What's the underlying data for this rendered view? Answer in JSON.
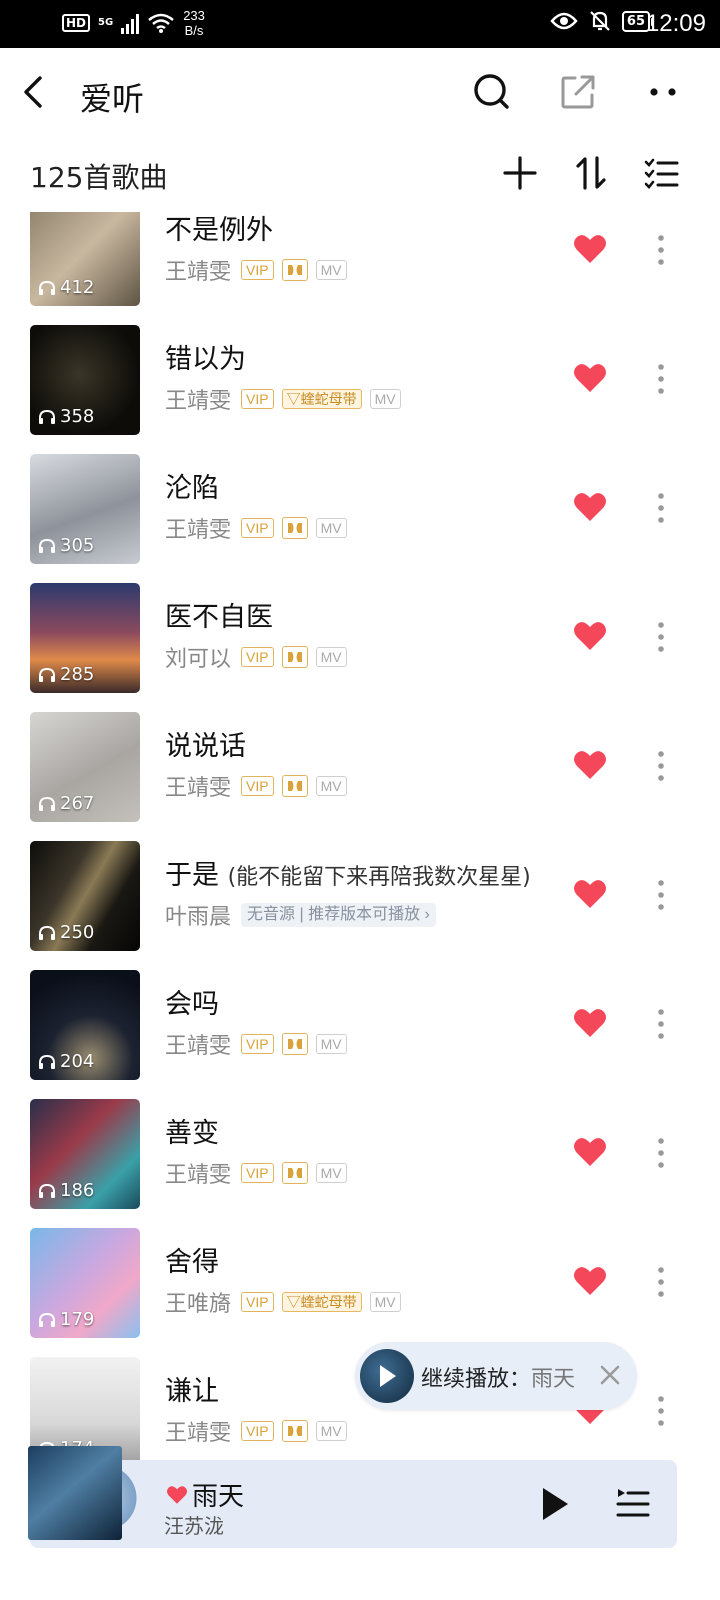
{
  "status_bar": {
    "hd": "HD",
    "network": "5G",
    "speed_value": "233",
    "speed_unit": "B/s",
    "battery": "65",
    "time": "12:09"
  },
  "header": {
    "title": "爱听",
    "icons": [
      "back-icon",
      "search-icon",
      "share-icon",
      "more-icon"
    ]
  },
  "list_header": {
    "count_label": "125首歌曲",
    "icons": [
      "add-icon",
      "sort-icon",
      "multi-select-icon"
    ]
  },
  "tags": {
    "vip": "VIP",
    "mv": "MV",
    "snake": "蝰蛇母带"
  },
  "songs": [
    {
      "title": "不是例外",
      "artist": "王靖雯",
      "plays": "412"
    },
    {
      "title": "错以为",
      "artist": "王靖雯",
      "plays": "358"
    },
    {
      "title": "沦陷",
      "artist": "王靖雯",
      "plays": "305"
    },
    {
      "title": "医不自医",
      "artist": "刘可以",
      "plays": "285"
    },
    {
      "title": "说说话",
      "artist": "王靖雯",
      "plays": "267"
    },
    {
      "title": "于是",
      "subtitle": "(能不能留下来再陪我数次星星)",
      "artist": "叶雨晨",
      "plays": "250",
      "note": "无音源 | 推荐版本可播放 ›"
    },
    {
      "title": "会吗",
      "artist": "王靖雯",
      "plays": "204"
    },
    {
      "title": "善变",
      "artist": "王靖雯",
      "plays": "186"
    },
    {
      "title": "舍得",
      "artist": "王唯旖",
      "plays": "179"
    },
    {
      "title": "谦让",
      "artist": "王靖雯",
      "plays": "174"
    }
  ],
  "resume": {
    "label": "继续播放：",
    "song": "雨天"
  },
  "player": {
    "title": "雨天",
    "artist": "汪苏泷"
  },
  "colors": {
    "heart": "#f4475a",
    "vip": "#d9a23a",
    "player_bg": "#e4ebf6"
  }
}
